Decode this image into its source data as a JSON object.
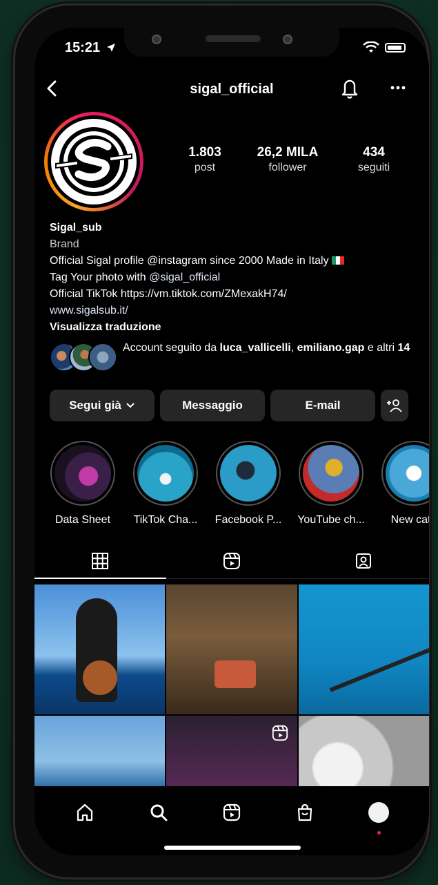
{
  "status": {
    "time": "15:21"
  },
  "header": {
    "username": "sigal_official"
  },
  "profile": {
    "stats": [
      {
        "num": "1.803",
        "label": "post"
      },
      {
        "num": "26,2 MILA",
        "label": "follower"
      },
      {
        "num": "434",
        "label": "seguiti"
      }
    ],
    "name": "Sigal_sub",
    "category": "Brand",
    "bio_line1": "Official Sigal profile  @instagram since 2000 Made in Italy",
    "bio_line2_prefix": "Tag Your photo with ",
    "bio_line2_mention": "@sigal_official",
    "bio_line3": "Official TikTok https://vm.tiktok.com/ZMexakH74/",
    "website": "www.sigalsub.it/",
    "translate": "Visualizza traduzione",
    "followed_prefix": "Account seguito da ",
    "followed_user1": "luca_vallicelli",
    "followed_sep": ", ",
    "followed_user2": "emiliano.gap",
    "followed_mid": " e altri ",
    "followed_count": "14"
  },
  "actions": {
    "follow": "Segui già",
    "message": "Messaggio",
    "email": "E-mail"
  },
  "highlights": [
    {
      "label": "Data  Sheet"
    },
    {
      "label": "TikTok Cha..."
    },
    {
      "label": "Facebook P..."
    },
    {
      "label": "YouTube ch..."
    },
    {
      "label": "New cata"
    }
  ],
  "colors": {
    "background": "#000000",
    "button": "#262626",
    "ring_accent": "#e91e63",
    "ring_warm": "#f9a825"
  },
  "icons": {
    "tabs": [
      "grid-icon",
      "reels-icon",
      "tagged-icon"
    ],
    "nav": [
      "home-icon",
      "search-icon",
      "reels-icon",
      "shop-icon",
      "profile-avatar"
    ]
  }
}
